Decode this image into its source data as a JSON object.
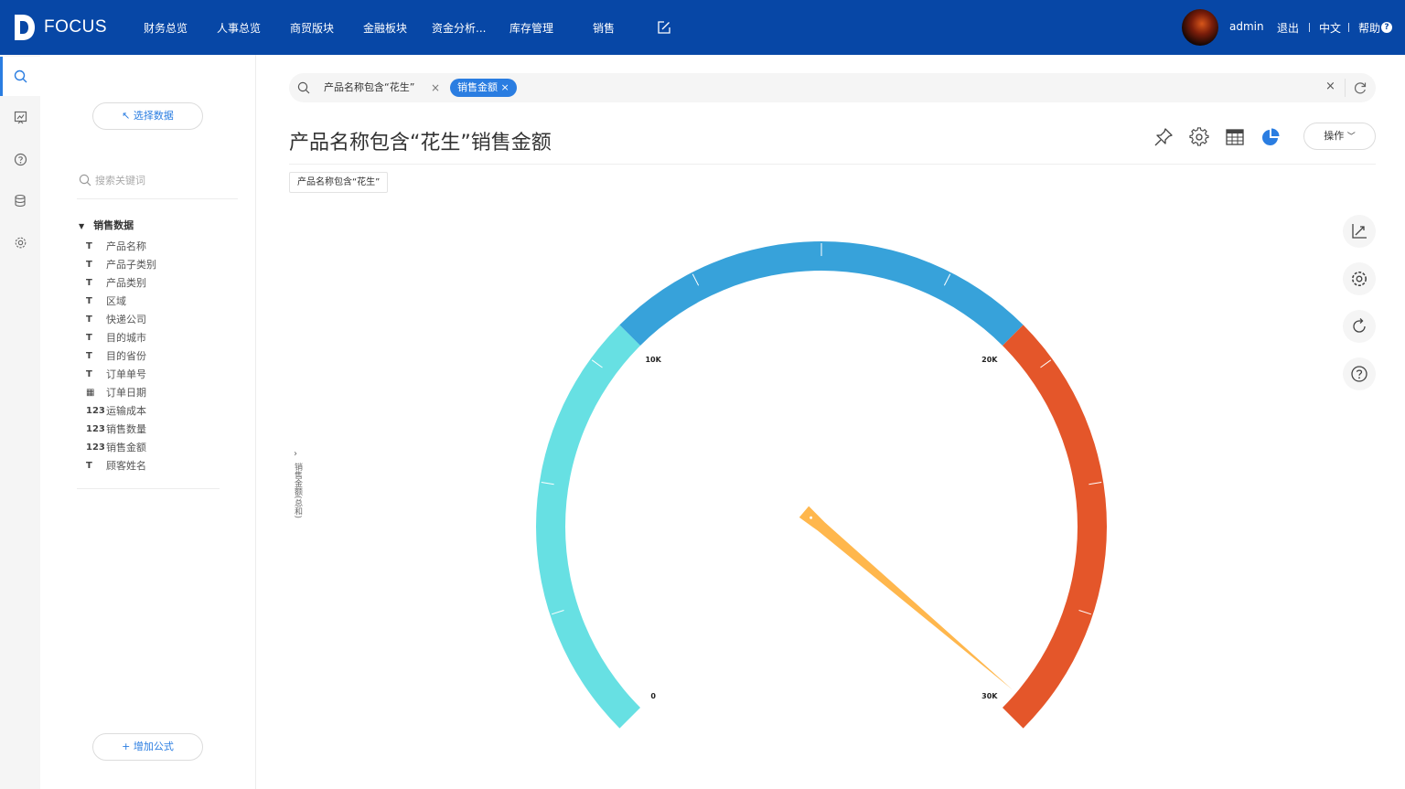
{
  "app": {
    "logo_text": "FOCUS",
    "nav": [
      "财务总览",
      "人事总览",
      "商贸版块",
      "金融板块",
      "资金分析...",
      "库存管理",
      "销售"
    ],
    "user": "admin",
    "logout": "退出",
    "language": "中文",
    "help": "帮助"
  },
  "rail": {
    "icons": [
      "search-icon",
      "board-icon",
      "question-icon",
      "database-icon",
      "settings-icon"
    ]
  },
  "panel": {
    "select_data": "↖ 选择数据",
    "search_placeholder": "搜索关键词",
    "group": "销售数据",
    "fields": [
      {
        "type": "text",
        "label": "产品名称"
      },
      {
        "type": "text",
        "label": "产品子类别"
      },
      {
        "type": "text",
        "label": "产品类别"
      },
      {
        "type": "text",
        "label": "区域"
      },
      {
        "type": "text",
        "label": "快递公司"
      },
      {
        "type": "text",
        "label": "目的城市"
      },
      {
        "type": "text",
        "label": "目的省份"
      },
      {
        "type": "text",
        "label": "订单单号"
      },
      {
        "type": "date",
        "label": "订单日期"
      },
      {
        "type": "number",
        "label": "运输成本"
      },
      {
        "type": "number",
        "label": "销售数量"
      },
      {
        "type": "number",
        "label": "销售金额"
      },
      {
        "type": "text",
        "label": "顾客姓名"
      }
    ],
    "add_formula": "+ 增加公式"
  },
  "query": {
    "tokens": [
      "产品名称包含“花生”",
      "销售金额"
    ]
  },
  "main": {
    "title": "产品名称包含“花生”销售金额",
    "operations": "操作",
    "filter_tag": "产品名称包含“花生”",
    "y_axis_label": "销售金额(总和)"
  },
  "colors": {
    "brand": "#0747a6",
    "accent": "#2a7de1",
    "band_low": "#67e0e3",
    "band_mid": "#37a2da",
    "band_high": "#e4562a",
    "needle": "#ffb74d"
  },
  "chart_data": {
    "type": "gauge",
    "min": 0,
    "max": 30000,
    "value": 29500,
    "series_name": "销售金额(总和)",
    "bands": [
      {
        "from": 0,
        "to": 10000,
        "color": "#67e0e3"
      },
      {
        "from": 10000,
        "to": 20000,
        "color": "#37a2da"
      },
      {
        "from": 20000,
        "to": 30000,
        "color": "#e4562a"
      }
    ],
    "tick_labels": [
      "0",
      "10K",
      "20K",
      "30K"
    ]
  }
}
